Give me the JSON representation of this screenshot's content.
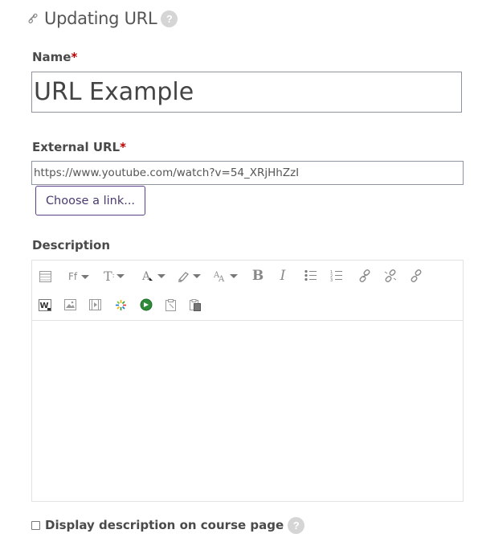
{
  "header": {
    "title": "Updating URL",
    "help": "?"
  },
  "name_field": {
    "label": "Name",
    "required": "*",
    "value": "URL Example"
  },
  "url_field": {
    "label": "External URL",
    "required": "*",
    "value": "https://www.youtube.com/watch?v=54_XRjHhZzI",
    "choose_label": "Choose a link..."
  },
  "description": {
    "label": "Description",
    "toolbar": {
      "font_family": "Ff",
      "font_size": "T",
      "bold": "B",
      "italic": "I",
      "wiris": "W"
    }
  },
  "display_description": {
    "label": "Display description on course page",
    "help": "?"
  },
  "icons": [
    "link-icon",
    "help-icon",
    "show-more-icon",
    "font-family-icon",
    "font-size-icon",
    "font-color-icon",
    "background-color-icon",
    "style-icon",
    "bold-icon",
    "italic-icon",
    "unordered-list-icon",
    "ordered-list-icon",
    "link-insert-icon",
    "unlink-icon",
    "anchor-icon",
    "wiris-icon",
    "image-icon",
    "media-icon",
    "h5p-icon",
    "recordrtc-icon",
    "paste-icon",
    "paste-special-icon"
  ]
}
